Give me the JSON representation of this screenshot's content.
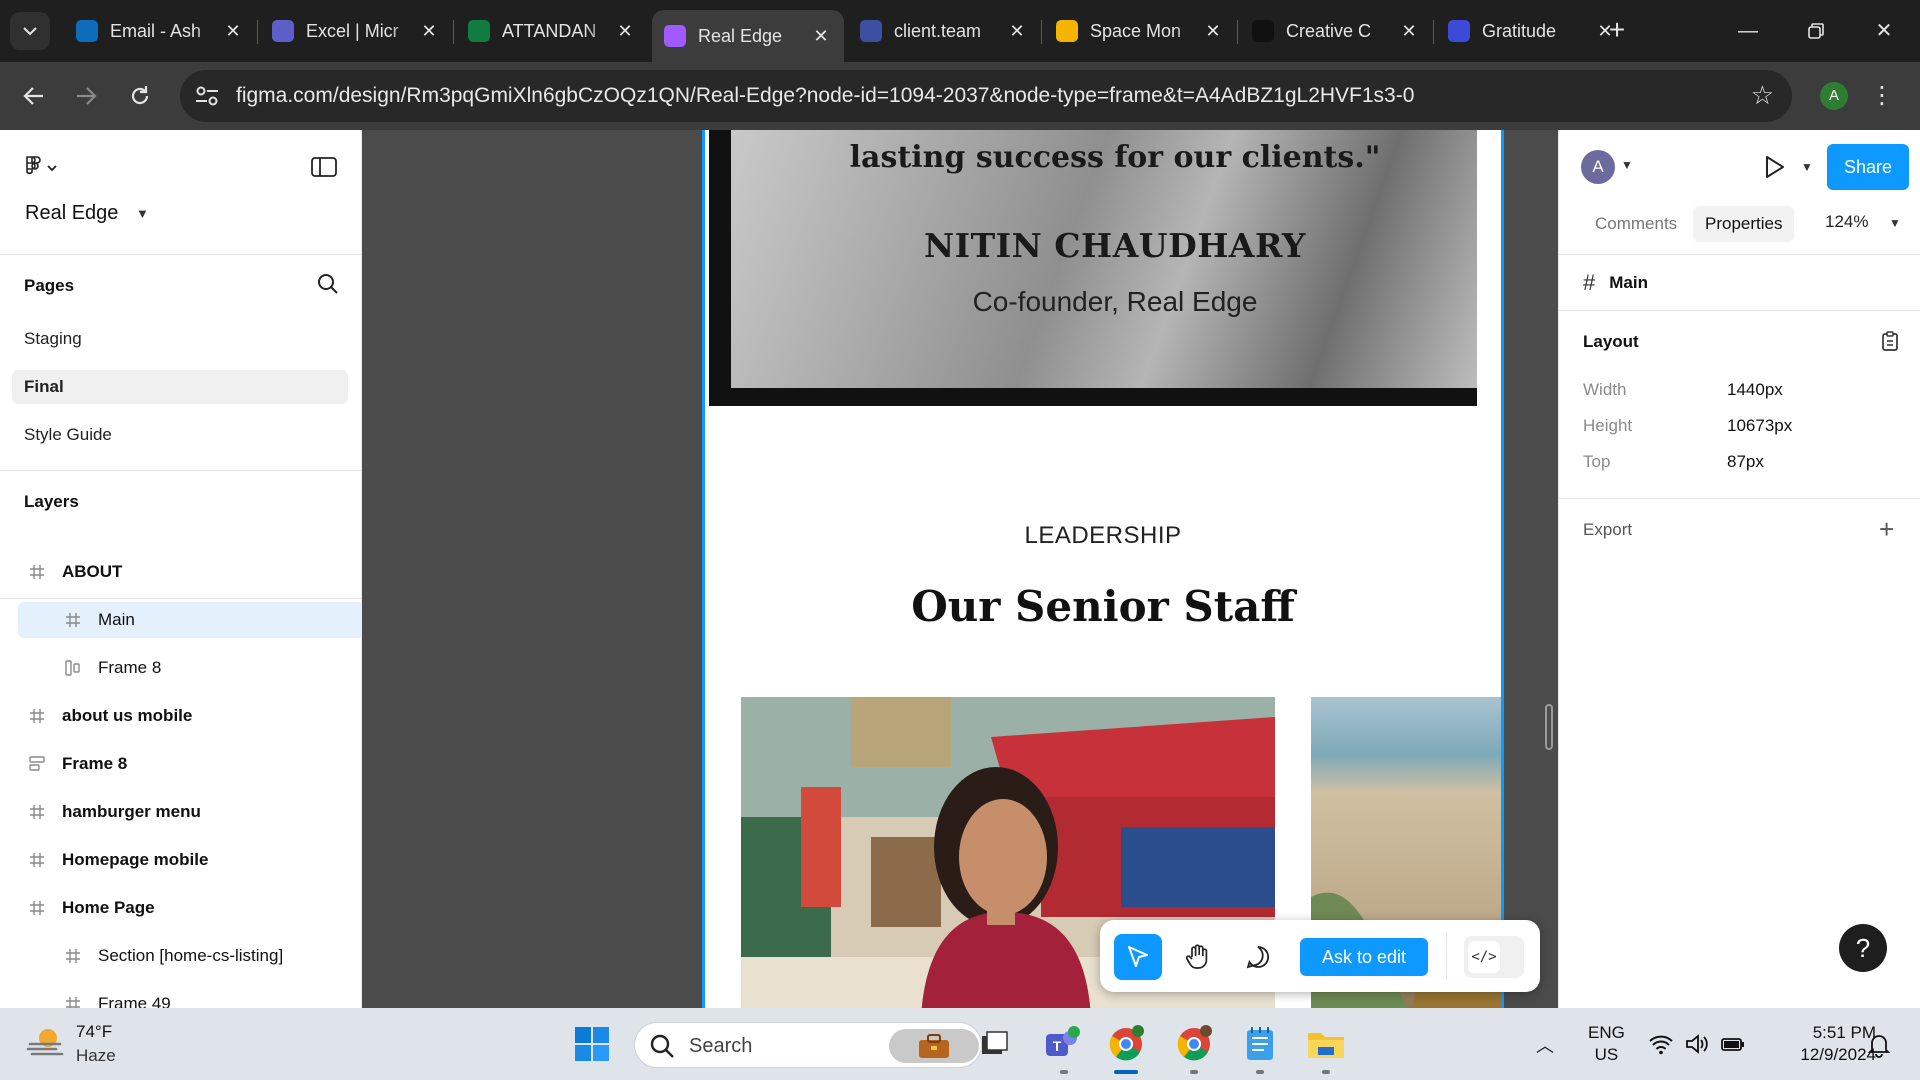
{
  "browser": {
    "tabs": [
      {
        "title": "Email - Ash",
        "favicon": "outlook-icon",
        "color": "#0f6cbd"
      },
      {
        "title": "Excel | Micr",
        "favicon": "copilot-icon",
        "color": "#5b5fc7"
      },
      {
        "title": "ATTANDAN",
        "favicon": "excel-icon",
        "color": "#107c41"
      },
      {
        "title": "Real Edge",
        "favicon": "figma-icon",
        "color": "#a259ff",
        "active": true
      },
      {
        "title": "client.team",
        "favicon": "tl-icon",
        "color": "#3d4f9f"
      },
      {
        "title": "Space Mon",
        "favicon": "diamond-icon",
        "color": "#f4b400"
      },
      {
        "title": "Creative C",
        "favicon": "chatgpt-icon",
        "color": "#111111"
      },
      {
        "title": "Gratitude",
        "favicon": "gratitude-icon",
        "color": "#3b4bd8"
      }
    ],
    "url": "figma.com/design/Rm3pqGmiXln6gbCzOQz1QN/Real-Edge?node-id=1094-2037&node-type=frame&t=A4AdBZ1gL2HVF1s3-0",
    "profile_initial": "A"
  },
  "left_panel": {
    "file_name": "Real Edge",
    "pages_title": "Pages",
    "pages": [
      {
        "label": "Staging",
        "selected": false
      },
      {
        "label": "Final",
        "selected": true
      },
      {
        "label": "Style Guide",
        "selected": false
      }
    ],
    "layers_title": "Layers",
    "layers": [
      {
        "label": "ABOUT",
        "icon": "frame-icon",
        "indent": 0,
        "selected": false
      },
      {
        "label": "Main",
        "icon": "frame-icon",
        "indent": 1,
        "selected": true
      },
      {
        "label": "Frame 8",
        "icon": "auto-layout-vertical-icon",
        "indent": 1,
        "selected": false
      },
      {
        "label": "about us mobile",
        "icon": "frame-icon",
        "indent": 0,
        "selected": false
      },
      {
        "label": "Frame 8",
        "icon": "auto-layout-horizontal-icon",
        "indent": 0,
        "selected": false
      },
      {
        "label": "hamburger menu",
        "icon": "frame-icon",
        "indent": 0,
        "selected": false
      },
      {
        "label": "Homepage mobile",
        "icon": "frame-icon",
        "indent": 0,
        "selected": false
      },
      {
        "label": "Home Page",
        "icon": "frame-icon",
        "indent": 0,
        "selected": false
      },
      {
        "label": "Section [home-cs-listing]",
        "icon": "frame-icon",
        "indent": 1,
        "selected": false
      },
      {
        "label": "Frame 49",
        "icon": "frame-icon",
        "indent": 1,
        "selected": false
      }
    ]
  },
  "canvas": {
    "quote_text": "lasting success for our clients.\"",
    "quote_name": "NITIN CHAUDHARY",
    "quote_role": "Co-founder, Real Edge",
    "section_label": "LEADERSHIP",
    "section_heading": "Our Senior Staff",
    "toolbar": {
      "ask_to_edit": "Ask to edit"
    }
  },
  "right_panel": {
    "avatar_initial": "A",
    "share_label": "Share",
    "tabs": [
      "Comments",
      "Properties"
    ],
    "active_tab": "Properties",
    "zoom": "124%",
    "selected_frame": "Main",
    "layout_title": "Layout",
    "properties": [
      {
        "label": "Width",
        "value": "1440px"
      },
      {
        "label": "Height",
        "value": "10673px"
      },
      {
        "label": "Top",
        "value": "87px"
      }
    ],
    "export_title": "Export",
    "help": "?"
  },
  "taskbar": {
    "weather_temp": "74°F",
    "weather_cond": "Haze",
    "search_placeholder": "Search",
    "lang_line1": "ENG",
    "lang_line2": "US",
    "time": "5:51 PM",
    "date": "12/9/2024"
  },
  "colors": {
    "figma_blue": "#0d99ff",
    "canvas_bg": "#4b4b4b",
    "browser_dark": "#1f1f1f"
  }
}
